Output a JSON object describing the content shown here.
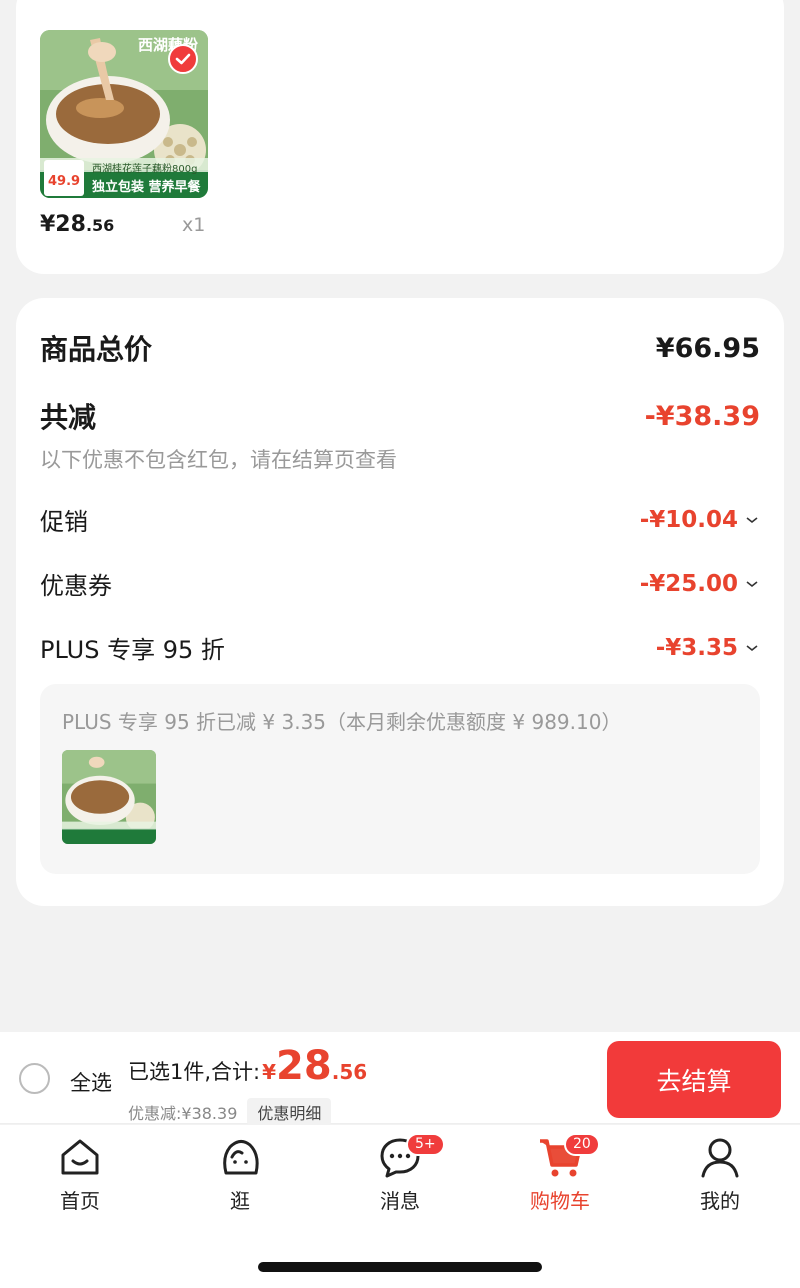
{
  "product": {
    "image_caption_top": "西湖藕粉",
    "image_caption_line": "西湖桂花莲子藕粉800g",
    "image_tag": "独立包装 营养早餐",
    "image_price": "49.9",
    "price_int": "¥28",
    "price_dec": ".56",
    "quantity": "x1"
  },
  "summary": {
    "total_label": "商品总价",
    "total_value": "¥66.95",
    "reduce_label": "共减",
    "reduce_value": "-¥38.39",
    "note": "以下优惠不包含红包，请在结算页查看",
    "items": [
      {
        "label": "促销",
        "value": "-¥10.04"
      },
      {
        "label": "优惠券",
        "value": "-¥25.00"
      },
      {
        "label": "PLUS 专享 95 折",
        "value": "-¥3.35"
      }
    ],
    "plus_detail": "PLUS 专享 95 折已减 ¥ 3.35（本月剩余优惠额度 ¥ 989.10）"
  },
  "checkout": {
    "select_all": "全选",
    "selected_text": "已选1件,合计:",
    "total_symbol": "¥",
    "total_int": "28",
    "total_dec": ".56",
    "discount_text": "优惠减:¥38.39",
    "discount_detail": "优惠明细",
    "pay_button": "去结算"
  },
  "tabs": [
    {
      "label": "首页",
      "icon": "home-icon"
    },
    {
      "label": "逛",
      "icon": "stroll-icon"
    },
    {
      "label": "消息",
      "icon": "message-icon",
      "badge": "5+"
    },
    {
      "label": "购物车",
      "icon": "cart-icon",
      "badge": "20",
      "active": true
    },
    {
      "label": "我的",
      "icon": "profile-icon"
    }
  ],
  "colors": {
    "accent": "#e8432e",
    "button": "#f23a3a"
  }
}
